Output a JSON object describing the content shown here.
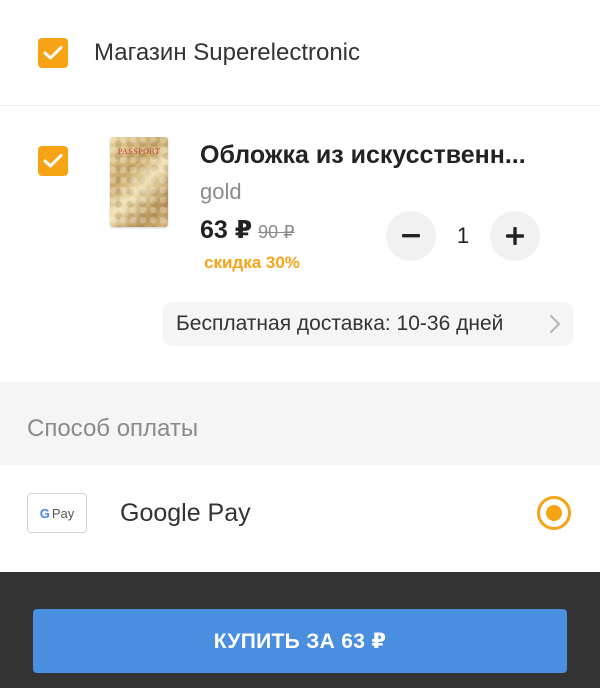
{
  "store": {
    "checked": true,
    "name": "Магазин Superelectronic"
  },
  "product": {
    "checked": true,
    "image_text": "PASSPORT",
    "title": "Обложка из искусственн...",
    "variant": "gold",
    "price": "63 ₽",
    "old_price": "90 ₽",
    "discount": "скидка 30%",
    "quantity": "1",
    "shipping": "Бесплатная доставка: 10-36 дней"
  },
  "payment": {
    "section_title": "Способ оплаты",
    "method_logo_g": "G",
    "method_logo_pay": "Pay",
    "method_name": "Google Pay",
    "selected": true
  },
  "checkout": {
    "buy_label": "КУПИТЬ ЗА 63 ₽"
  },
  "colors": {
    "accent": "#f6a316",
    "button": "#4a8ee0",
    "bottom_bar": "#333333"
  }
}
